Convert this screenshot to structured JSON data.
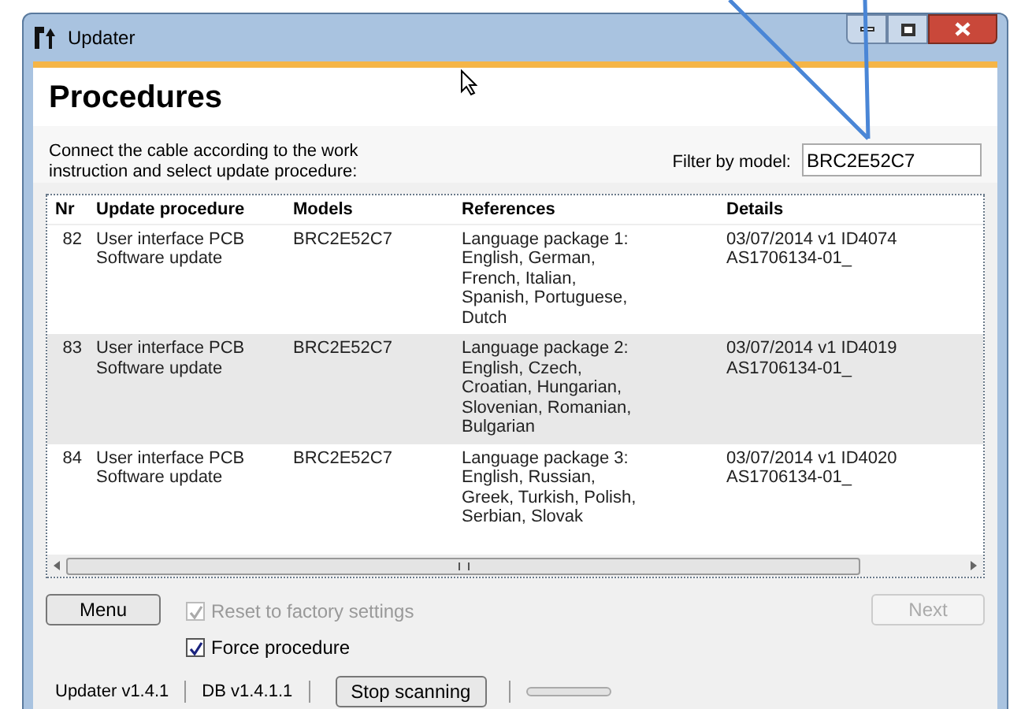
{
  "window": {
    "title": "Updater"
  },
  "heading": "Procedures",
  "instruction": "Connect the cable according to the work instruction and select update procedure:",
  "filter": {
    "label": "Filter by model:",
    "value": "BRC2E52C7"
  },
  "table": {
    "columns": [
      "Nr",
      "Update procedure",
      "Models",
      "References",
      "Details"
    ],
    "rows": [
      {
        "highlighted": false,
        "cells": [
          "82",
          "User interface PCB Software update",
          "BRC2E52C7",
          "Language package 1: English, German, French, Italian, Spanish, Portuguese, Dutch",
          "03/07/2014 v1 ID4074 AS1706134-01_"
        ]
      },
      {
        "highlighted": true,
        "cells": [
          "83",
          "User interface PCB Software update",
          "BRC2E52C7",
          "Language package 2: English, Czech, Croatian, Hungarian, Slovenian, Romanian, Bulgarian",
          "03/07/2014 v1 ID4019 AS1706134-01_"
        ]
      },
      {
        "highlighted": false,
        "cells": [
          "84",
          "User interface PCB Software update",
          "BRC2E52C7",
          "Language package 3: English, Russian, Greek, Turkish, Polish, Serbian, Slovak",
          "03/07/2014 v1 ID4020 AS1706134-01_"
        ]
      }
    ]
  },
  "menu_button": {
    "label": "Menu"
  },
  "options": [
    {
      "label": "Reset to factory settings",
      "checked": true,
      "disabled": true
    },
    {
      "label": "Force procedure",
      "checked": true,
      "disabled": false
    }
  ],
  "next_button": {
    "label": "Next",
    "disabled": true
  },
  "status_bar": {
    "updater_version": "Updater v1.4.1",
    "db_version": "DB v1.4.1.1",
    "scan_button": "Stop scanning",
    "progress": {
      "level": 0
    }
  }
}
